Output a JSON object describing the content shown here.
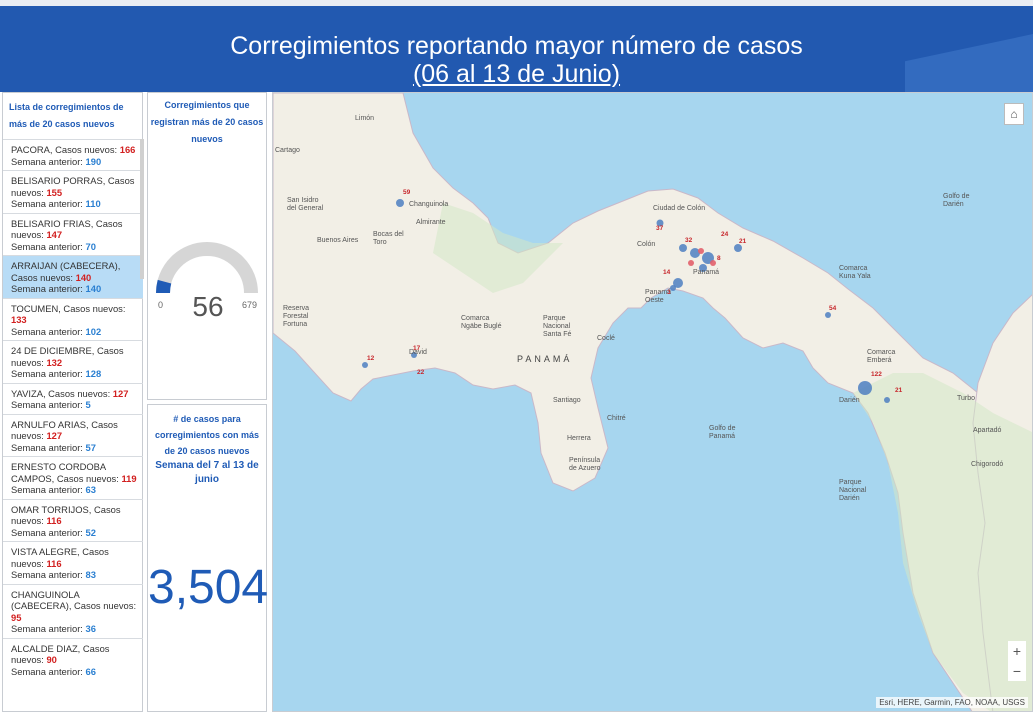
{
  "header": {
    "title": "Corregimientos reportando mayor número de casos",
    "subtitle": "(06 al 13 de Junio)"
  },
  "list_panel": {
    "title": "Lista de corregimientos de más de 20 casos nuevos",
    "items": [
      {
        "name": "PACORA, Casos nuevos: ",
        "new": "166",
        "prev_label": "Semana anterior: ",
        "prev": "190",
        "selected": false
      },
      {
        "name": "BELISARIO PORRAS, Casos nuevos: ",
        "new": "155",
        "prev_label": "Semana anterior: ",
        "prev": "110",
        "selected": false
      },
      {
        "name": "BELISARIO FRIAS, Casos nuevos: ",
        "new": "147",
        "prev_label": "Semana anterior: ",
        "prev": "70",
        "selected": false
      },
      {
        "name": "ARRAIJAN (CABECERA), Casos nuevos: ",
        "new": "140",
        "prev_label": "Semana anterior: ",
        "prev": "140",
        "selected": true
      },
      {
        "name": "TOCUMEN, Casos nuevos: ",
        "new": "133",
        "prev_label": "Semana anterior: ",
        "prev": "102",
        "selected": false
      },
      {
        "name": "24 DE DICIEMBRE, Casos nuevos: ",
        "new": "132",
        "prev_label": "Semana anterior: ",
        "prev": "128",
        "selected": false
      },
      {
        "name": "YAVIZA, Casos nuevos: ",
        "new": "127",
        "prev_label": "Semana anterior: ",
        "prev": "5",
        "selected": false
      },
      {
        "name": "ARNULFO ARIAS, Casos nuevos: ",
        "new": "127",
        "prev_label": "Semana anterior: ",
        "prev": "57",
        "selected": false
      },
      {
        "name": "ERNESTO CORDOBA CAMPOS, Casos nuevos: ",
        "new": "119",
        "prev_label": "Semana anterior: ",
        "prev": "63",
        "selected": false
      },
      {
        "name": "OMAR TORRIJOS, Casos nuevos: ",
        "new": "116",
        "prev_label": "Semana anterior: ",
        "prev": "52",
        "selected": false
      },
      {
        "name": "VISTA ALEGRE, Casos nuevos: ",
        "new": "116",
        "prev_label": "Semana anterior: ",
        "prev": "83",
        "selected": false
      },
      {
        "name": "CHANGUINOLA (CABECERA), Casos nuevos: ",
        "new": "95",
        "prev_label": "Semana anterior: ",
        "prev": "36",
        "selected": false
      },
      {
        "name": "ALCALDE DIAZ, Casos nuevos: ",
        "new": "90",
        "prev_label": "Semana anterior: ",
        "prev": "66",
        "selected": false
      }
    ]
  },
  "gauge_panel": {
    "title": "Corregimientos que registran más de 20 casos nuevos",
    "value": "56",
    "min": "0",
    "max": "679",
    "fraction": 0.0825,
    "fill_color": "#1f5bb6",
    "track_color": "#d6d6d6"
  },
  "total_panel": {
    "title": "# de casos para corregimientos con más de 20 casos nuevos",
    "period": "Semana del 7 al 13 de junio",
    "value": "3,504"
  },
  "map": {
    "labels": {
      "limon": "Limón",
      "cartago": "Cartago",
      "san_isidro": "San Isidro del General",
      "buenos_aires": "Buenos Aires",
      "changuinola": "Changuinola",
      "almirante": "Almirante",
      "bocas": "Bocas del Toro",
      "reserva": "Reserva Forestal Fortuna",
      "comarca_ngabe": "Comarca Ngäbe Buglé",
      "parque": "Parque Nacional Santa Fé",
      "david": "David",
      "panama_country": "PANAMÁ",
      "cocle": "Coclé",
      "santiago": "Santiago",
      "chitre": "Chitré",
      "herrera": "Herrera",
      "peninsula": "Península de Azuero",
      "golfo_panama": "Golfo de Panamá",
      "ciudad_colon": "Ciudad de Colón",
      "colon": "Colón",
      "panama_city": "Panamá",
      "panama_oeste": "Panamá Oeste",
      "comarca_kuna": "Comarca Kuna Yala",
      "comarca_embera": "Comarca Emberá",
      "darien": "Darién",
      "parque_darien": "Parque Nacional Darién",
      "golfo_darien": "Golfo de Darién",
      "turbo": "Turbo",
      "apartado": "Apartadó",
      "chigorodo": "Chigorodó"
    },
    "case_labels": [
      "59",
      "37",
      "12",
      "17",
      "22",
      "54",
      "122",
      "21",
      "32",
      "24",
      "21",
      "14",
      "3",
      "8"
    ],
    "attribution": "Esri, HERE, Garmin, FAO, NOAA, USGS",
    "zoom_in": "+",
    "zoom_out": "−"
  }
}
